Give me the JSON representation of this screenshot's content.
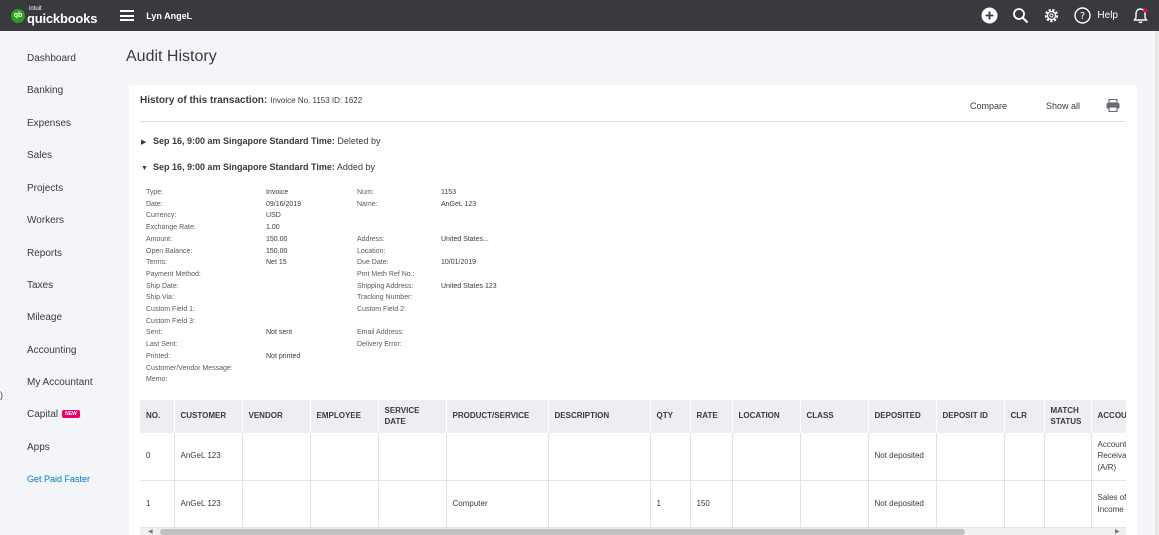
{
  "brand": {
    "intuit": "intuit",
    "name": "quickbooks"
  },
  "company": "Lyn AngeL",
  "topbar": {
    "help_label": "Help"
  },
  "sidebar": {
    "items": [
      "Dashboard",
      "Banking",
      "Expenses",
      "Sales",
      "Projects",
      "Workers",
      "Reports",
      "Taxes",
      "Mileage",
      "Accounting",
      "My Accountant",
      "Capital",
      "Apps"
    ],
    "capital_badge": "NEW",
    "link": "Get Paid Faster"
  },
  "page": {
    "title": "Audit History"
  },
  "history": {
    "label": "History of this transaction:",
    "info": "Invoice No. 1153 ID: 1622",
    "compare": "Compare",
    "show_all": "Show all"
  },
  "entries": [
    {
      "time": "Sep 16, 9:00 am Singapore Standard Time:",
      "action": "Deleted by",
      "expanded": false
    },
    {
      "time": "Sep 16, 9:00 am Singapore Standard Time:",
      "action": "Added by",
      "expanded": true
    }
  ],
  "details_left": [
    {
      "label": "Type:",
      "value": "Invoice"
    },
    {
      "label": "Date:",
      "value": "09/16/2019"
    },
    {
      "label": "Currency:",
      "value": "USD"
    },
    {
      "label": "Exchange Rate:",
      "value": "1.00"
    },
    {
      "label": "Amount:",
      "value": "150.00"
    },
    {
      "label": "Open Balance:",
      "value": "150.00"
    },
    {
      "label": "Terms:",
      "value": "Net 15"
    },
    {
      "label": "Payment Method:",
      "value": ""
    },
    {
      "label": "Ship Date:",
      "value": ""
    },
    {
      "label": "Ship Via:",
      "value": ""
    },
    {
      "label": "Custom Field 1:",
      "value": ""
    },
    {
      "label": "Custom Field 3:",
      "value": ""
    },
    {
      "label": "Sent:",
      "value": "Not sent"
    },
    {
      "label": "Last Sent:",
      "value": ""
    },
    {
      "label": "Printed:",
      "value": "Not printed"
    },
    {
      "label": "Customer/Vendor Message:",
      "value": ""
    },
    {
      "label": "Memo:",
      "value": ""
    }
  ],
  "details_right": [
    {
      "label": "Num:",
      "value": "1153"
    },
    {
      "label": "Name:",
      "value": "AnGeL 123"
    },
    {
      "label": "",
      "value": ""
    },
    {
      "label": "",
      "value": ""
    },
    {
      "label": "Address:",
      "value": "United States..."
    },
    {
      "label": "Location:",
      "value": ""
    },
    {
      "label": "Due Date:",
      "value": "10/01/2019"
    },
    {
      "label": "Pmt Meth Ref No.:",
      "value": ""
    },
    {
      "label": "Shipping Address:",
      "value": "United States 123"
    },
    {
      "label": "Tracking Number:",
      "value": ""
    },
    {
      "label": "Custom Field 2:",
      "value": ""
    },
    {
      "label": "",
      "value": ""
    },
    {
      "label": "Email Address:",
      "value": ""
    },
    {
      "label": "Delivery Error:",
      "value": ""
    }
  ],
  "table": {
    "headers": [
      "NO.",
      "CUSTOMER",
      "VENDOR",
      "EMPLOYEE",
      "SERVICE DATE",
      "PRODUCT/SERVICE",
      "DESCRIPTION",
      "QTY",
      "RATE",
      "LOCATION",
      "CLASS",
      "DEPOSITED",
      "DEPOSIT ID",
      "CLR",
      "MATCH STATUS",
      "ACCOUNT"
    ],
    "rows": [
      [
        "0",
        "AnGeL 123",
        "",
        "",
        "",
        "",
        "",
        "",
        "",
        "",
        "",
        "Not deposited",
        "",
        "",
        "",
        "Accounts Receivable (A/R)"
      ],
      [
        "1",
        "AnGeL 123",
        "",
        "",
        "",
        "Computer",
        "",
        "1",
        "150",
        "",
        "",
        "Not deposited",
        "",
        "",
        "",
        "Sales of Product Income"
      ]
    ]
  },
  "colors": {
    "topbar": "#393a3d",
    "brand_green": "#2ca01c",
    "link_blue": "#0077c5",
    "badge_pink": "#e5006b"
  }
}
